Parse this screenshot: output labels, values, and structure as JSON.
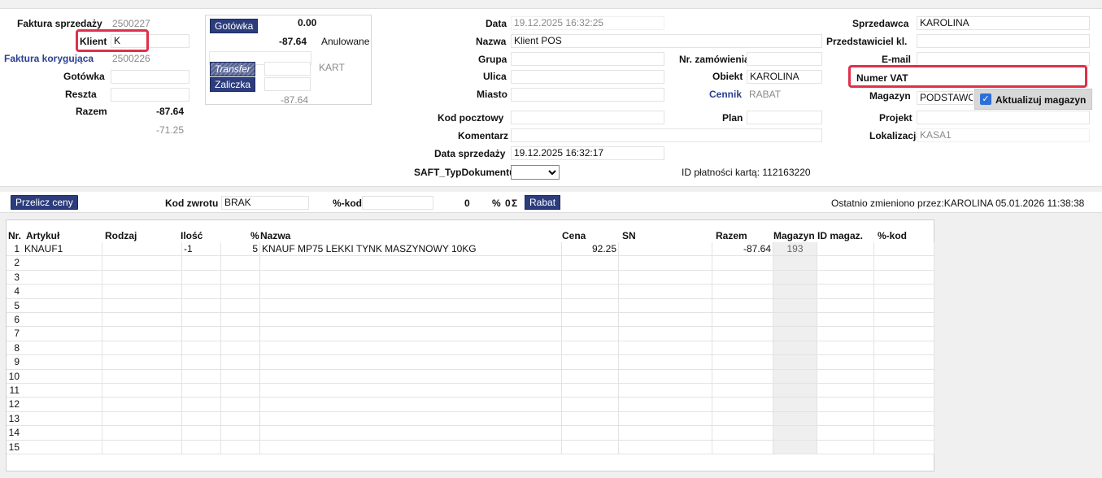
{
  "invoice": {
    "faktura_sprzedazy_label": "Faktura sprzedaży",
    "faktura_sprzedazy_value": "2500227",
    "klient_label": "Klient",
    "klient_value": "K",
    "faktura_korygujaca_label": "Faktura korygująca",
    "faktura_korygujaca_value": "2500226",
    "gotowka_label": "Gotówka",
    "reszta_label": "Reszta",
    "razem_label": "Razem",
    "razem_value": "-87.64",
    "razem_sub_value": "-71.25"
  },
  "payment": {
    "gotowka_button": "Gotówka",
    "gotowka_amount": "0.00",
    "anulowane_amount": "-87.64",
    "anulowane_label": "Anulowane",
    "transfer_button": "Transfer",
    "kart_text": "KART",
    "zaliczka_button": "Zaliczka",
    "zaliczka_amount": "-87.64"
  },
  "center": {
    "data_label": "Data",
    "data_value": "19.12.2025 16:32:25",
    "nazwa_label": "Nazwa",
    "nazwa_value": "Klient POS",
    "grupa_label": "Grupa",
    "ulica_label": "Ulica",
    "miasto_label": "Miasto",
    "kod_pocztowy_label": "Kod pocztowy",
    "komentarz_label": "Komentarz",
    "data_sprzedazy_label": "Data sprzedaży",
    "data_sprzedazy_value": "19.12.2025 16:32:17",
    "saft_label": "SAFT_TypDokumentu",
    "saft_value": ""
  },
  "center_right": {
    "nr_zamowienia_label": "Nr. zamówienia",
    "obiekt_label": "Obiekt",
    "obiekt_value": "KAROLINA",
    "cennik_label": "Cennik",
    "cennik_value": "RABAT",
    "plan_label": "Plan",
    "id_platnosci_text": "ID płatności kartą: 112163220"
  },
  "right": {
    "sprzedawca_label": "Sprzedawca",
    "sprzedawca_value": "KAROLINA",
    "przedstawiciel_label": "Przedstawiciel kl.",
    "email_label": "E-mail",
    "numer_vat_label": "Numer VAT",
    "magazyn_label": "Magazyn",
    "magazyn_value": "PODSTAWOWY",
    "aktualizuj_label": "Aktualizuj magazyn",
    "projekt_label": "Projekt",
    "lokalizacja_label": "Lokalizacja",
    "lokalizacja_value": "KASA1"
  },
  "midbar": {
    "przelicz_button": "Przelicz ceny",
    "kod_zwrotu_label": "Kod zwrotu",
    "kod_zwrotu_value": "BRAK",
    "pkod_label": "%-kod",
    "pkod_value": "",
    "zero_value": "0",
    "percent_label": "%",
    "percent_value": "0",
    "sigma": "Σ",
    "rabat_button": "Rabat",
    "last_changed": "Ostatnio zmieniono przez:KAROLINA 05.01.2026 11:38:38"
  },
  "grid": {
    "headers": {
      "nr": "Nr.",
      "artykul": "Artykuł",
      "rodzaj": "Rodzaj",
      "ilosc": "Ilość",
      "pct": "%",
      "nazwa": "Nazwa",
      "cena": "Cena",
      "sn": "SN",
      "razem": "Razem",
      "magazyn": "Magazyn",
      "id_magaz": "ID magaz.",
      "pkod": "%-kod"
    },
    "rows": [
      {
        "nr": "1",
        "artykul": "KNAUF1",
        "rodzaj": "",
        "ilosc": "-1",
        "pct": "5",
        "nazwa": "KNAUF MP75 LEKKI TYNK MASZYNOWY 10KG",
        "cena": "92.25",
        "sn": "",
        "razem": "-87.64",
        "magazyn": "193",
        "id_magaz": "",
        "pkod": ""
      },
      {
        "nr": "2"
      },
      {
        "nr": "3"
      },
      {
        "nr": "4"
      },
      {
        "nr": "5"
      },
      {
        "nr": "6"
      },
      {
        "nr": "7"
      },
      {
        "nr": "8"
      },
      {
        "nr": "9"
      },
      {
        "nr": "10"
      },
      {
        "nr": "11"
      },
      {
        "nr": "12"
      },
      {
        "nr": "13"
      },
      {
        "nr": "14"
      },
      {
        "nr": "15"
      }
    ]
  },
  "colors": {
    "highlight_box": "#e0304a",
    "button_navy": "#2c3d7d",
    "link_blue": "#2a3f8f"
  }
}
